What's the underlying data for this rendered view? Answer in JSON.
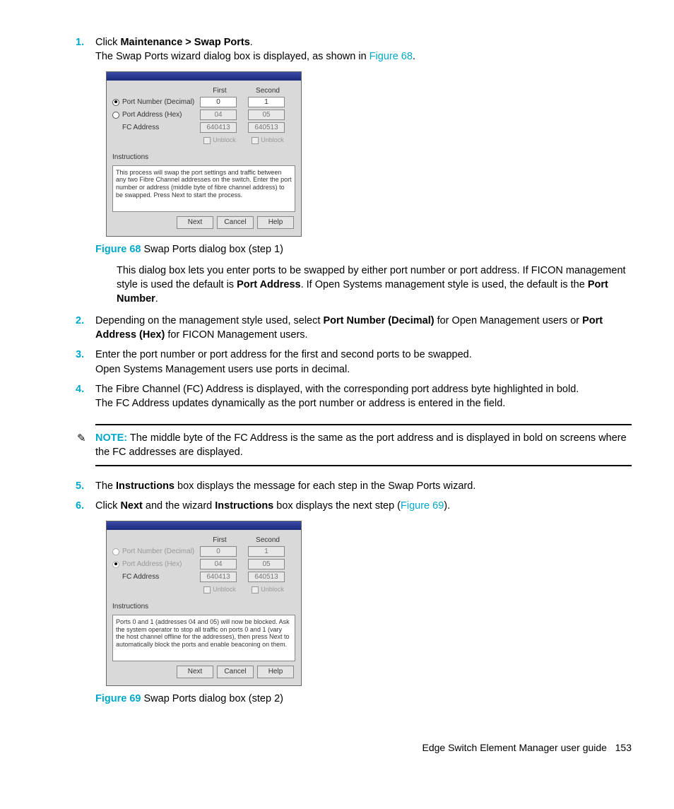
{
  "steps": {
    "s1": {
      "num": "1.",
      "pre": "Click ",
      "bold": "Maintenance > Swap Ports",
      "post": ".",
      "line2_pre": "The Swap Ports wizard dialog box is displayed, as shown in ",
      "link": "Figure 68",
      "line2_post": "."
    },
    "s2": {
      "num": "2.",
      "pre": "Depending on the management style used, select ",
      "b1": "Port Number (Decimal)",
      "mid": " for Open Management users or ",
      "b2": "Port Address (Hex)",
      "post": " for FICON Management users."
    },
    "s3": {
      "num": "3.",
      "l1": "Enter the port number or port address for the first and second ports to be swapped.",
      "l2": "Open Systems Management users use ports in decimal."
    },
    "s4": {
      "num": "4.",
      "l1": "The Fibre Channel (FC) Address is displayed, with the corresponding port address byte highlighted in bold.",
      "l2": "The FC Address updates dynamically as the port number or address is entered in the field."
    },
    "s5": {
      "num": "5.",
      "pre": "The ",
      "b": "Instructions",
      "post": " box displays the message for each step in the Swap Ports wizard."
    },
    "s6": {
      "num": "6.",
      "pre": "Click ",
      "b1": "Next",
      "mid": " and the wizard ",
      "b2": "Instructions",
      "post_pre": " box displays the next step (",
      "link": "Figure 69",
      "post_post": ")."
    }
  },
  "para1": {
    "t1": "This dialog box lets you enter ports to be swapped by either port number or port address. If FICON management style is used the default is ",
    "b1": "Port Address",
    "t2": ". If Open Systems management style is used, the default is the ",
    "b2": "Port Number",
    "t3": "."
  },
  "fig68": {
    "label": "Figure 68",
    "caption": " Swap Ports dialog box (step 1)"
  },
  "fig69": {
    "label": "Figure 69",
    "caption": " Swap Ports dialog box (step 2)"
  },
  "note": {
    "label": "NOTE:",
    "text": "   The middle byte of the FC Address is the same as the port address and is displayed in bold on screens where the FC addresses are displayed."
  },
  "footer": {
    "title": "Edge Switch Element Manager user guide",
    "page": "153"
  },
  "dialog": {
    "col1": "First",
    "col2": "Second",
    "row1": "Port Number (Decimal)",
    "row2": "Port Address (Hex)",
    "row3": "FC Address",
    "v_first_num": "0",
    "v_second_num": "1",
    "v_first_hex": "04",
    "v_second_hex": "05",
    "v_first_fc": "640413",
    "v_second_fc": "640513",
    "unblock": "Unblock",
    "instr_label": "Instructions",
    "instr1": "This process will swap the port settings and traffic between any two Fibre Channel addresses on the switch. Enter the port number or address (middle byte of fibre channel address) to be swapped. Press Next to start the process.",
    "instr2": "Ports 0 and 1 (addresses 04 and 05) will now be blocked. Ask the system operator to stop all traffic on ports 0 and 1 (vary the host channel offline for the addresses), then press Next to automatically block the ports and enable beaconing on them.",
    "btn_next": "Next",
    "btn_cancel": "Cancel",
    "btn_help": "Help"
  }
}
